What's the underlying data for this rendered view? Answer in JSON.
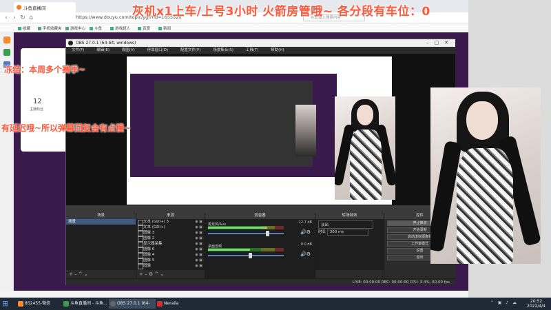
{
  "browser": {
    "tab_title": "斗鱼直播间",
    "url": "https://www.douyu.com/topic/ygl?rid=1655520",
    "search_placeholder": "在此输入搜索内容",
    "bookmarks": [
      "收藏",
      "手机收藏夹",
      "游戏中心",
      "斗鱼",
      "游戏超人",
      "百度",
      "新闻"
    ]
  },
  "page": {
    "count": "12",
    "count_caption": "主播粉丝"
  },
  "obs": {
    "title": "OBS 27.0.1 (64-bit, windows)",
    "menu": [
      "文件(F)",
      "编辑(E)",
      "视图(V)",
      "停靠窗口(D)",
      "配置文件(P)",
      "场景集合(S)",
      "工具(T)",
      "帮助(H)"
    ],
    "docks": {
      "scenes": "场景",
      "sources": "来源",
      "mixer": "混音器",
      "transitions": "转场特效",
      "controls": "控件"
    },
    "scene_items": [
      "场景"
    ],
    "sources": [
      "文本 (GDI+) 3",
      "文本 (GDI+)",
      "图像 3",
      "图像 2",
      "显示器采集",
      "图像 6",
      "图像 4",
      "图像 5",
      "图像"
    ],
    "mixer": [
      {
        "name": "麦克风/Aux",
        "db": "-12.7 dB",
        "level": 0.78
      },
      {
        "name": "桌面音频",
        "db": "0.0 dB",
        "level": 0.55
      }
    ],
    "transition": "淡出",
    "duration_label": "时长",
    "duration": "300 ms",
    "controls": [
      "停止推流",
      "开始录制",
      "启动虚拟摄像机",
      "工作室模式",
      "设置",
      "退出"
    ],
    "statusbar": "LIVE: 00:00:00   REC: 00:00:00   CPU: 3.4%, 60.00 fps"
  },
  "overlay": {
    "title": "灰机x1上车/上号3小时   火箭房管哦~   各分段有车位：0",
    "caption1": "冻结：本周多个赛季~",
    "caption2": "有延迟哦~所以弹幕回复会有点慢~"
  },
  "taskbar": {
    "items": [
      "852455-微信",
      "斗鱼直播间 - 斗鱼...",
      "OBS 27.0.1 (64-bi...",
      "Neralia"
    ],
    "time": "20:52",
    "date": "2022/4/4"
  },
  "colors": {
    "overlay_text": "#ff5a3c",
    "obs_bg": "#2b2b2b",
    "page_bg": "#3a1a4c"
  }
}
